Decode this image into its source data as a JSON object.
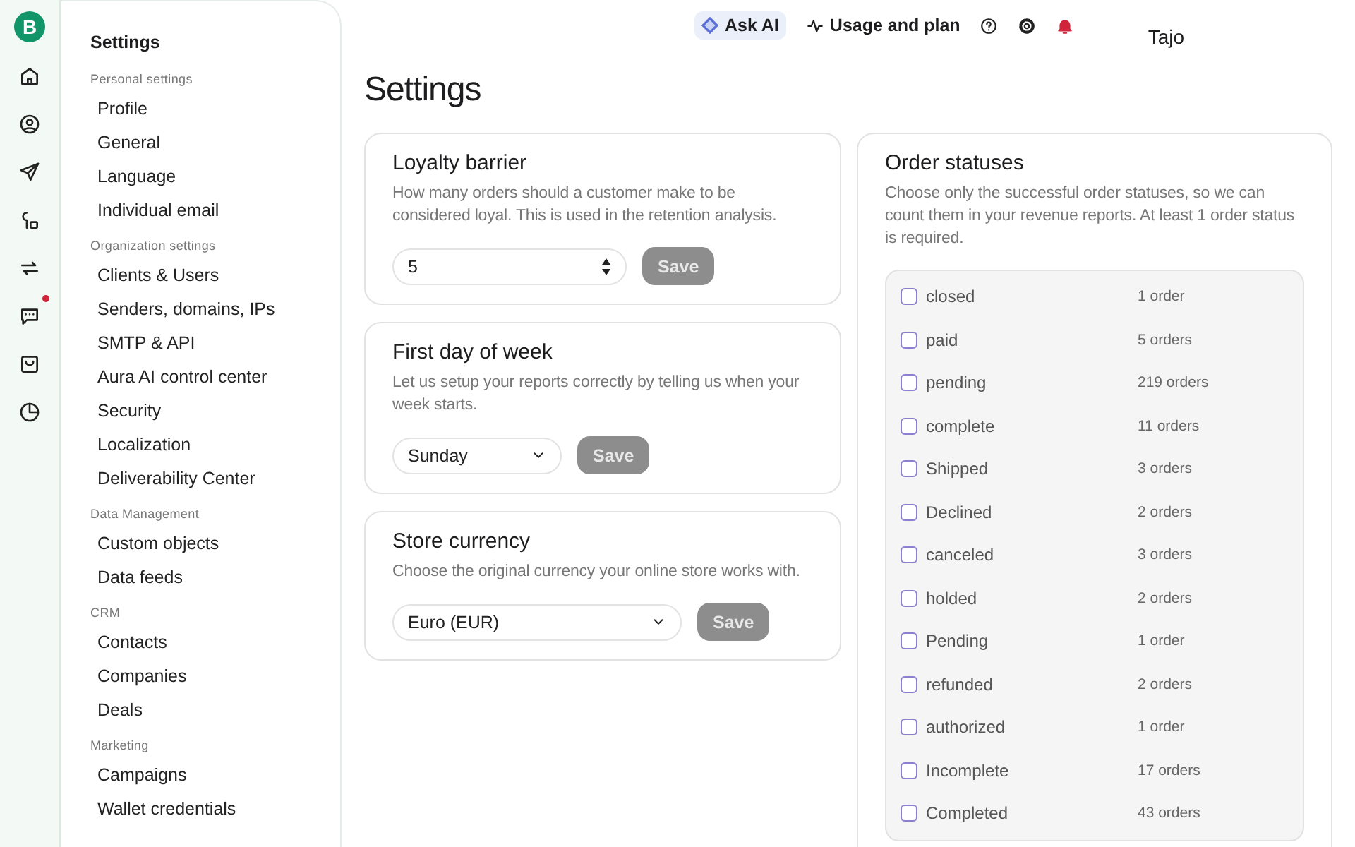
{
  "logo": "B",
  "rail": [
    {
      "notification": false
    },
    {
      "notification": false
    },
    {
      "notification": false
    },
    {
      "notification": false
    },
    {
      "notification": false
    },
    {
      "notification": true
    },
    {
      "notification": false
    },
    {
      "notification": false
    }
  ],
  "sidebar": {
    "title": "Settings",
    "sections": [
      {
        "label": "Personal settings",
        "items": [
          "Profile",
          "General",
          "Language",
          "Individual email"
        ]
      },
      {
        "label": "Organization settings",
        "items": [
          "Clients & Users",
          "Senders, domains, IPs",
          "SMTP & API",
          "Aura AI control center",
          "Security",
          "Localization",
          "Deliverability Center"
        ]
      },
      {
        "label": "Data Management",
        "items": [
          "Custom objects",
          "Data feeds"
        ]
      },
      {
        "label": "CRM",
        "items": [
          "Contacts",
          "Companies",
          "Deals"
        ]
      },
      {
        "label": "Marketing",
        "items": [
          "Campaigns",
          "Wallet credentials"
        ]
      }
    ]
  },
  "top_bar": {
    "ask_ai": "Ask AI",
    "usage": "Usage and plan",
    "user": "Tajo"
  },
  "page_title": "Settings",
  "cards": [
    {
      "kind": "number",
      "title": "Loyalty barrier",
      "description": "How many orders should a customer make to be considered loyal. This is used in the retention analysis.",
      "value": "5",
      "button": {
        "label": "Save",
        "disabled": true
      }
    },
    {
      "kind": "select",
      "title": "First day of week",
      "description": "Let us setup your reports correctly by telling us when your week starts.",
      "value": "Sunday",
      "button": {
        "label": "Save",
        "disabled": true
      }
    },
    {
      "kind": "select_wide",
      "title": "Store currency",
      "description": "Choose the original currency your online store works with.",
      "value": "Euro (EUR)",
      "button": {
        "label": "Save",
        "disabled": true
      }
    }
  ],
  "order_statuses": {
    "title": "Order statuses",
    "description": "Choose only the successful order statuses, so we can count them in your revenue reports. At least 1 order status is required.",
    "statuses": [
      {
        "name": "closed",
        "count": "1 order",
        "checked": false
      },
      {
        "name": "paid",
        "count": "5 orders",
        "checked": false
      },
      {
        "name": "pending",
        "count": "219 orders",
        "checked": false
      },
      {
        "name": "complete",
        "count": "11 orders",
        "checked": false
      },
      {
        "name": "Shipped",
        "count": "3 orders",
        "checked": false
      },
      {
        "name": "Declined",
        "count": "2 orders",
        "checked": false
      },
      {
        "name": "canceled",
        "count": "3 orders",
        "checked": false
      },
      {
        "name": "holded",
        "count": "2 orders",
        "checked": false
      },
      {
        "name": "Pending",
        "count": "1 order",
        "checked": false
      },
      {
        "name": "refunded",
        "count": "2 orders",
        "checked": false
      },
      {
        "name": "authorized",
        "count": "1 order",
        "checked": false
      },
      {
        "name": "Incomplete",
        "count": "17 orders",
        "checked": false
      },
      {
        "name": "Completed",
        "count": "43 orders",
        "checked": false
      }
    ]
  }
}
